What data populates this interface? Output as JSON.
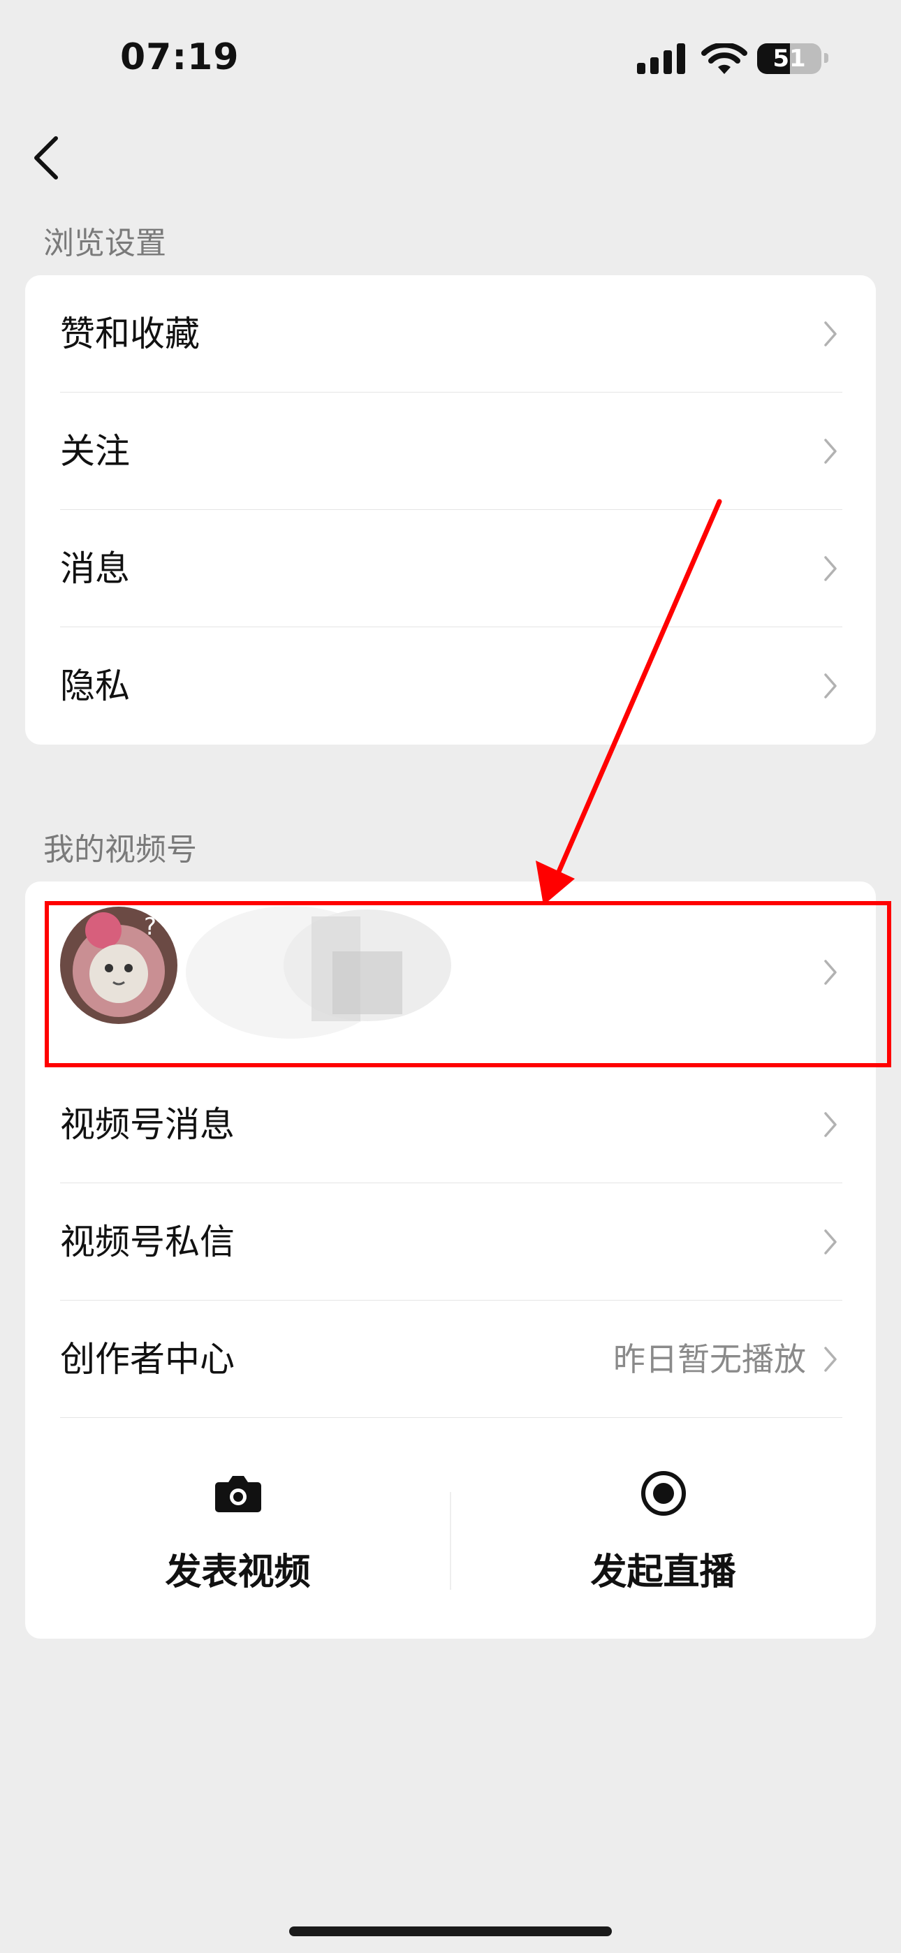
{
  "status_bar": {
    "time": "07:19",
    "battery_level": "51"
  },
  "sections": {
    "browse_settings": {
      "header": "浏览设置",
      "items": [
        {
          "label": "赞和收藏"
        },
        {
          "label": "关注"
        },
        {
          "label": "消息"
        },
        {
          "label": "隐私"
        }
      ]
    },
    "my_channel": {
      "header": "我的视频号",
      "items": [
        {
          "label": "视频号消息"
        },
        {
          "label": "视频号私信"
        },
        {
          "label": "创作者中心",
          "value": "昨日暂无播放"
        }
      ],
      "actions": [
        {
          "label": "发表视频",
          "icon": "camera-icon"
        },
        {
          "label": "发起直播",
          "icon": "live-record-icon"
        }
      ]
    }
  },
  "colors": {
    "background": "#ededed",
    "card": "#ffffff",
    "highlight": "#ff0000",
    "secondary_text": "#7a7a7a"
  }
}
